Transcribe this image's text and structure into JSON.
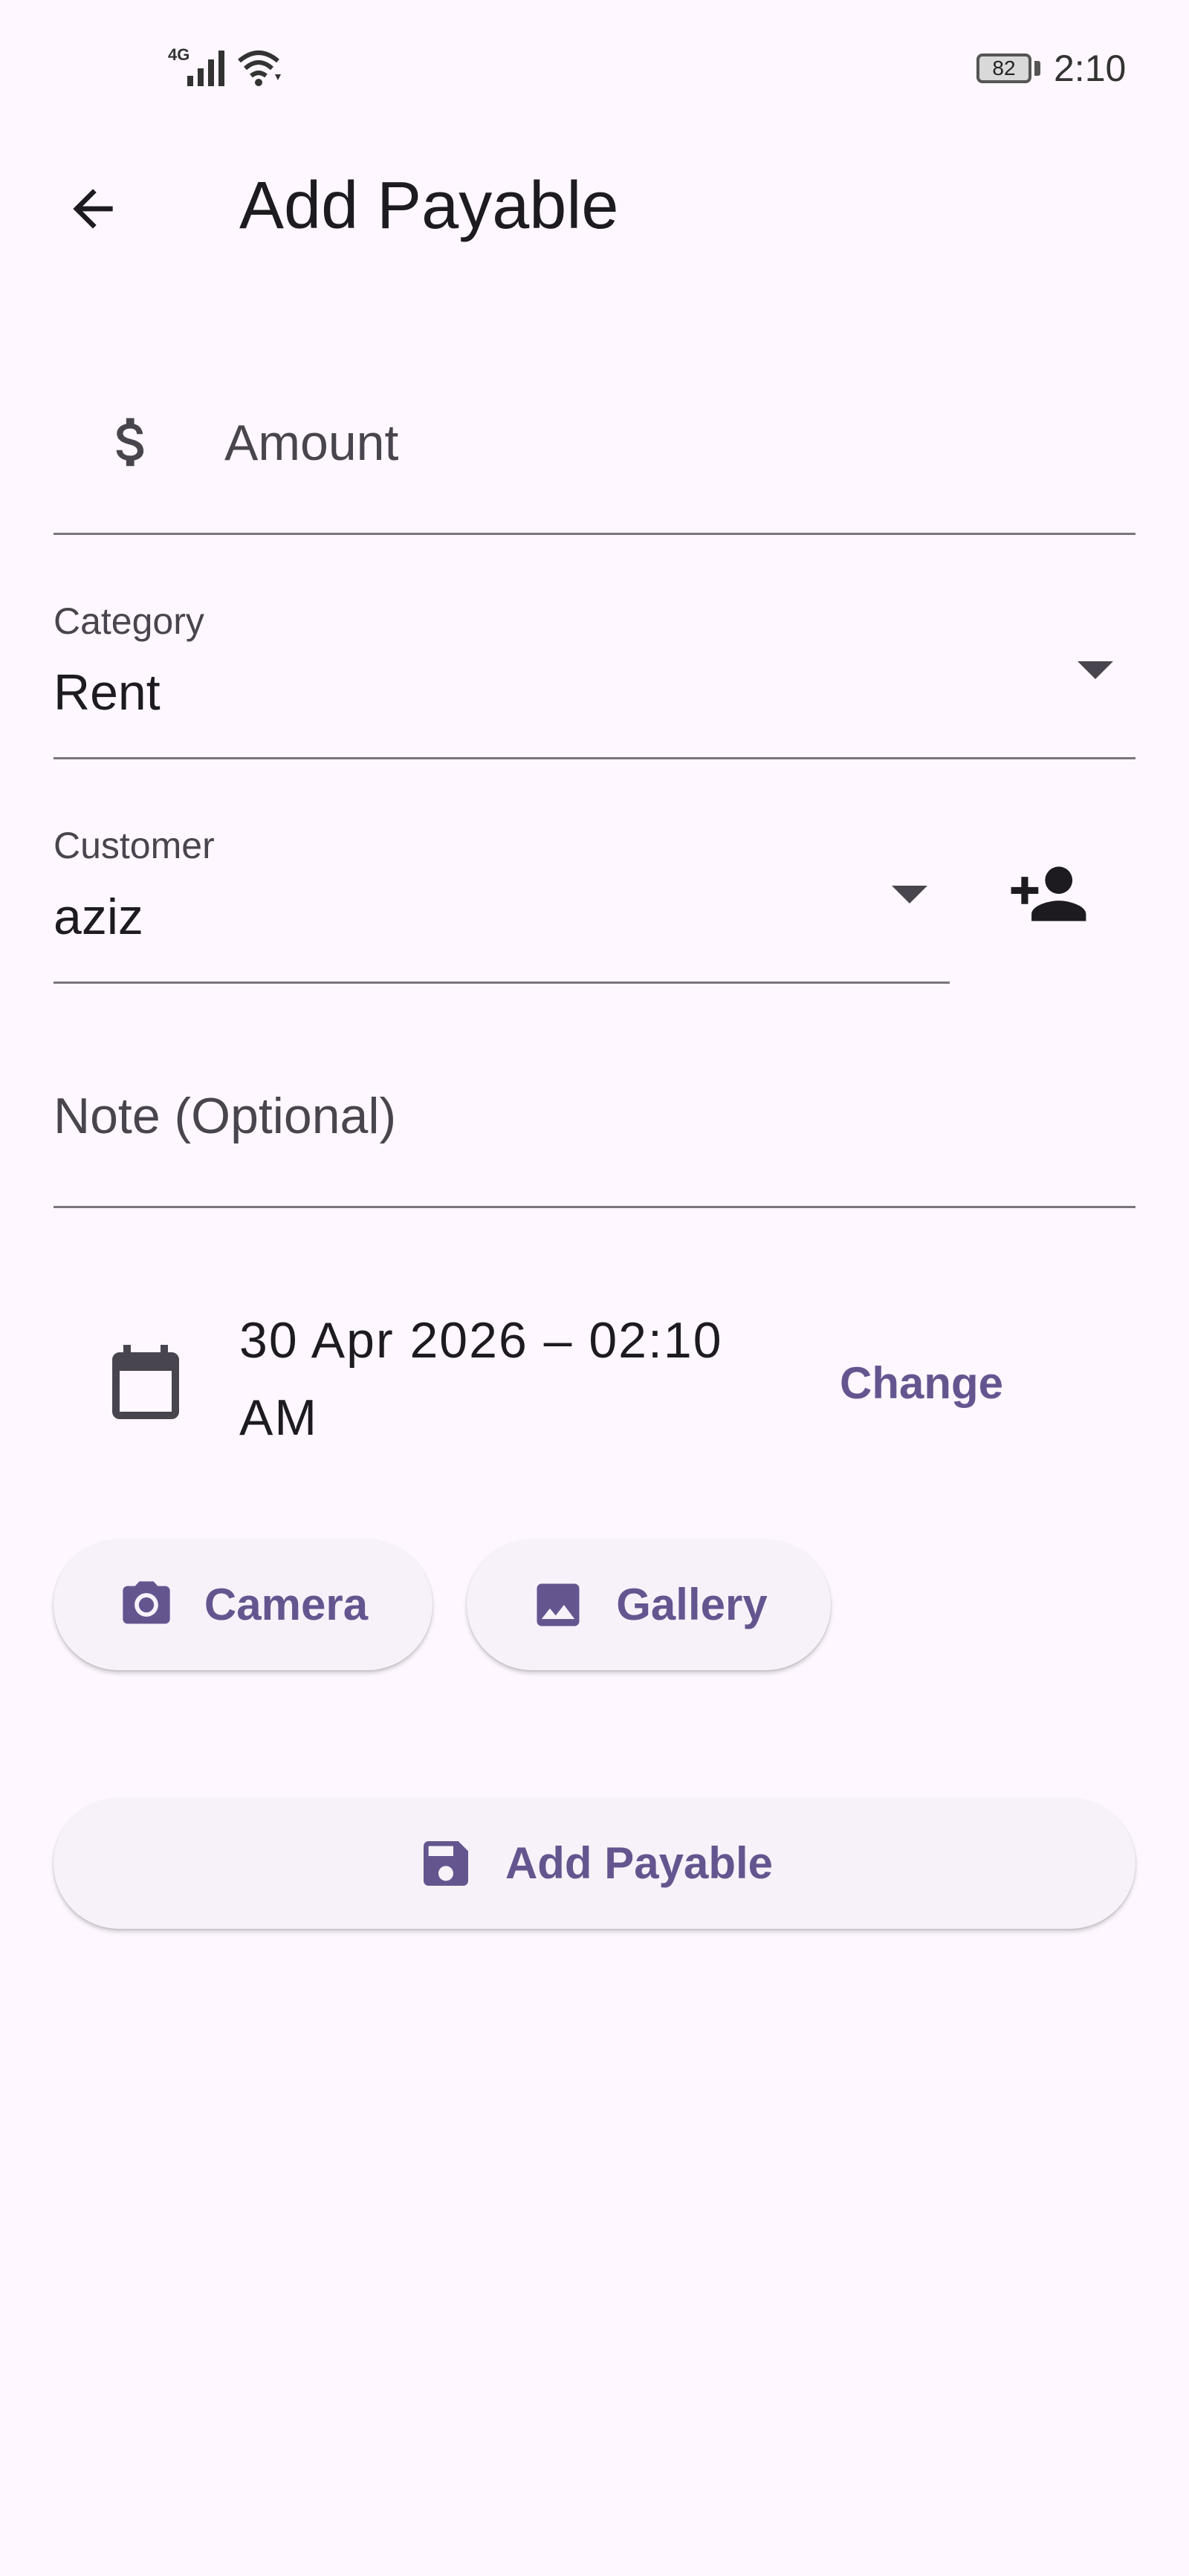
{
  "status_bar": {
    "network": "4G",
    "battery": "82",
    "time": "2:10"
  },
  "app_bar": {
    "title": "Add Payable",
    "back_icon": "arrow-back-icon"
  },
  "form": {
    "amount": {
      "icon": "dollar-icon",
      "placeholder": "Amount",
      "value": ""
    },
    "category": {
      "label": "Category",
      "value": "Rent"
    },
    "customer": {
      "label": "Customer",
      "value": "aziz",
      "add_icon": "add-person-icon"
    },
    "note": {
      "placeholder": "Note (Optional)",
      "value": ""
    },
    "date": {
      "icon": "calendar-icon",
      "value": "30 Apr 2026 – 02:10 AM",
      "change_label": "Change"
    },
    "attachments": {
      "camera_label": "Camera",
      "gallery_label": "Gallery"
    },
    "submit_label": "Add Payable"
  },
  "colors": {
    "background": "#FEF7FF",
    "accent": "#65558F",
    "text": "#1D1B20",
    "secondary_text": "#49454F",
    "divider": "#79747E",
    "button_surface": "#F7F2FA"
  }
}
